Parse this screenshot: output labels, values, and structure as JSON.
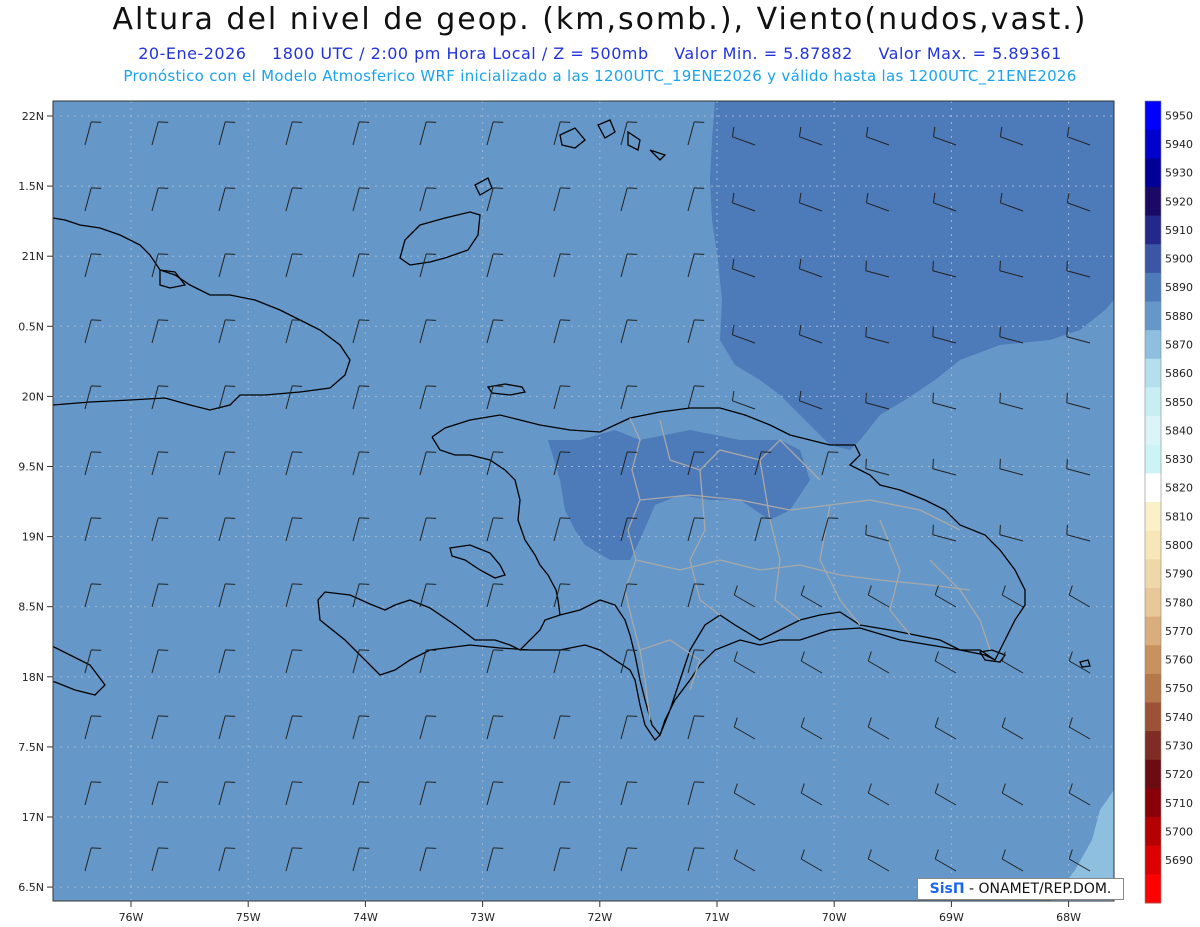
{
  "header": {
    "title": "Altura del nivel de geop. (km,somb.), Viento(nudos,vast.)",
    "date": "20-Ene-2026",
    "time": "1800 UTC / 2:00 pm Hora Local / Z = 500mb",
    "min_label": "Valor Min. = 5.87882",
    "max_label": "Valor Max. = 5.89361",
    "model_line": "Pronóstico con el Modelo Atmosferico WRF inicializado a las 1200UTC_19ENE2026 y válido hasta las  1200UTC_21ENE2026"
  },
  "axes": {
    "lat_ticks": [
      "22N",
      "1.5N",
      "21N",
      "0.5N",
      "20N",
      "9.5N",
      "19N",
      "8.5N",
      "18N",
      "7.5N",
      "17N",
      "6.5N"
    ],
    "lon_ticks": [
      "76W",
      "75W",
      "74W",
      "73W",
      "72W",
      "71W",
      "70W",
      "69W",
      "68W"
    ]
  },
  "colorbar": {
    "labels": [
      "5950",
      "5940",
      "5930",
      "5920",
      "5910",
      "5900",
      "5890",
      "5880",
      "5870",
      "5860",
      "5850",
      "5840",
      "5830",
      "5820",
      "5810",
      "5800",
      "5790",
      "5780",
      "5770",
      "5760",
      "5750",
      "5740",
      "5730",
      "5720",
      "5710",
      "5700",
      "5690"
    ],
    "colors": [
      "#0000ff",
      "#0000cc",
      "#000099",
      "#1a0a66",
      "#23288a",
      "#3a56a4",
      "#4d7ab8",
      "#6598c8",
      "#8fbfde",
      "#b4e0ee",
      "#c8eef4",
      "#daf4f8",
      "#ccf4f6",
      "#ffffff",
      "#fbf0c8",
      "#f6e6b8",
      "#efd8a8",
      "#e8c898",
      "#d9ae7c",
      "#c8925e",
      "#b4784a",
      "#9c5236",
      "#7e2c24",
      "#6a0c12",
      "#8a0008",
      "#b40000",
      "#dd0000",
      "#ff0000"
    ]
  },
  "map": {
    "field_colors": {
      "base": "#6598c8",
      "high": "#4d7ab8",
      "low": "#8fbfde"
    },
    "coast_color": "#000000",
    "border_color": "#aaaaaa",
    "barb_color": "#222222"
  },
  "credit": {
    "logo": "SisΠ",
    "text": " - ONAMET/REP.DOM."
  }
}
